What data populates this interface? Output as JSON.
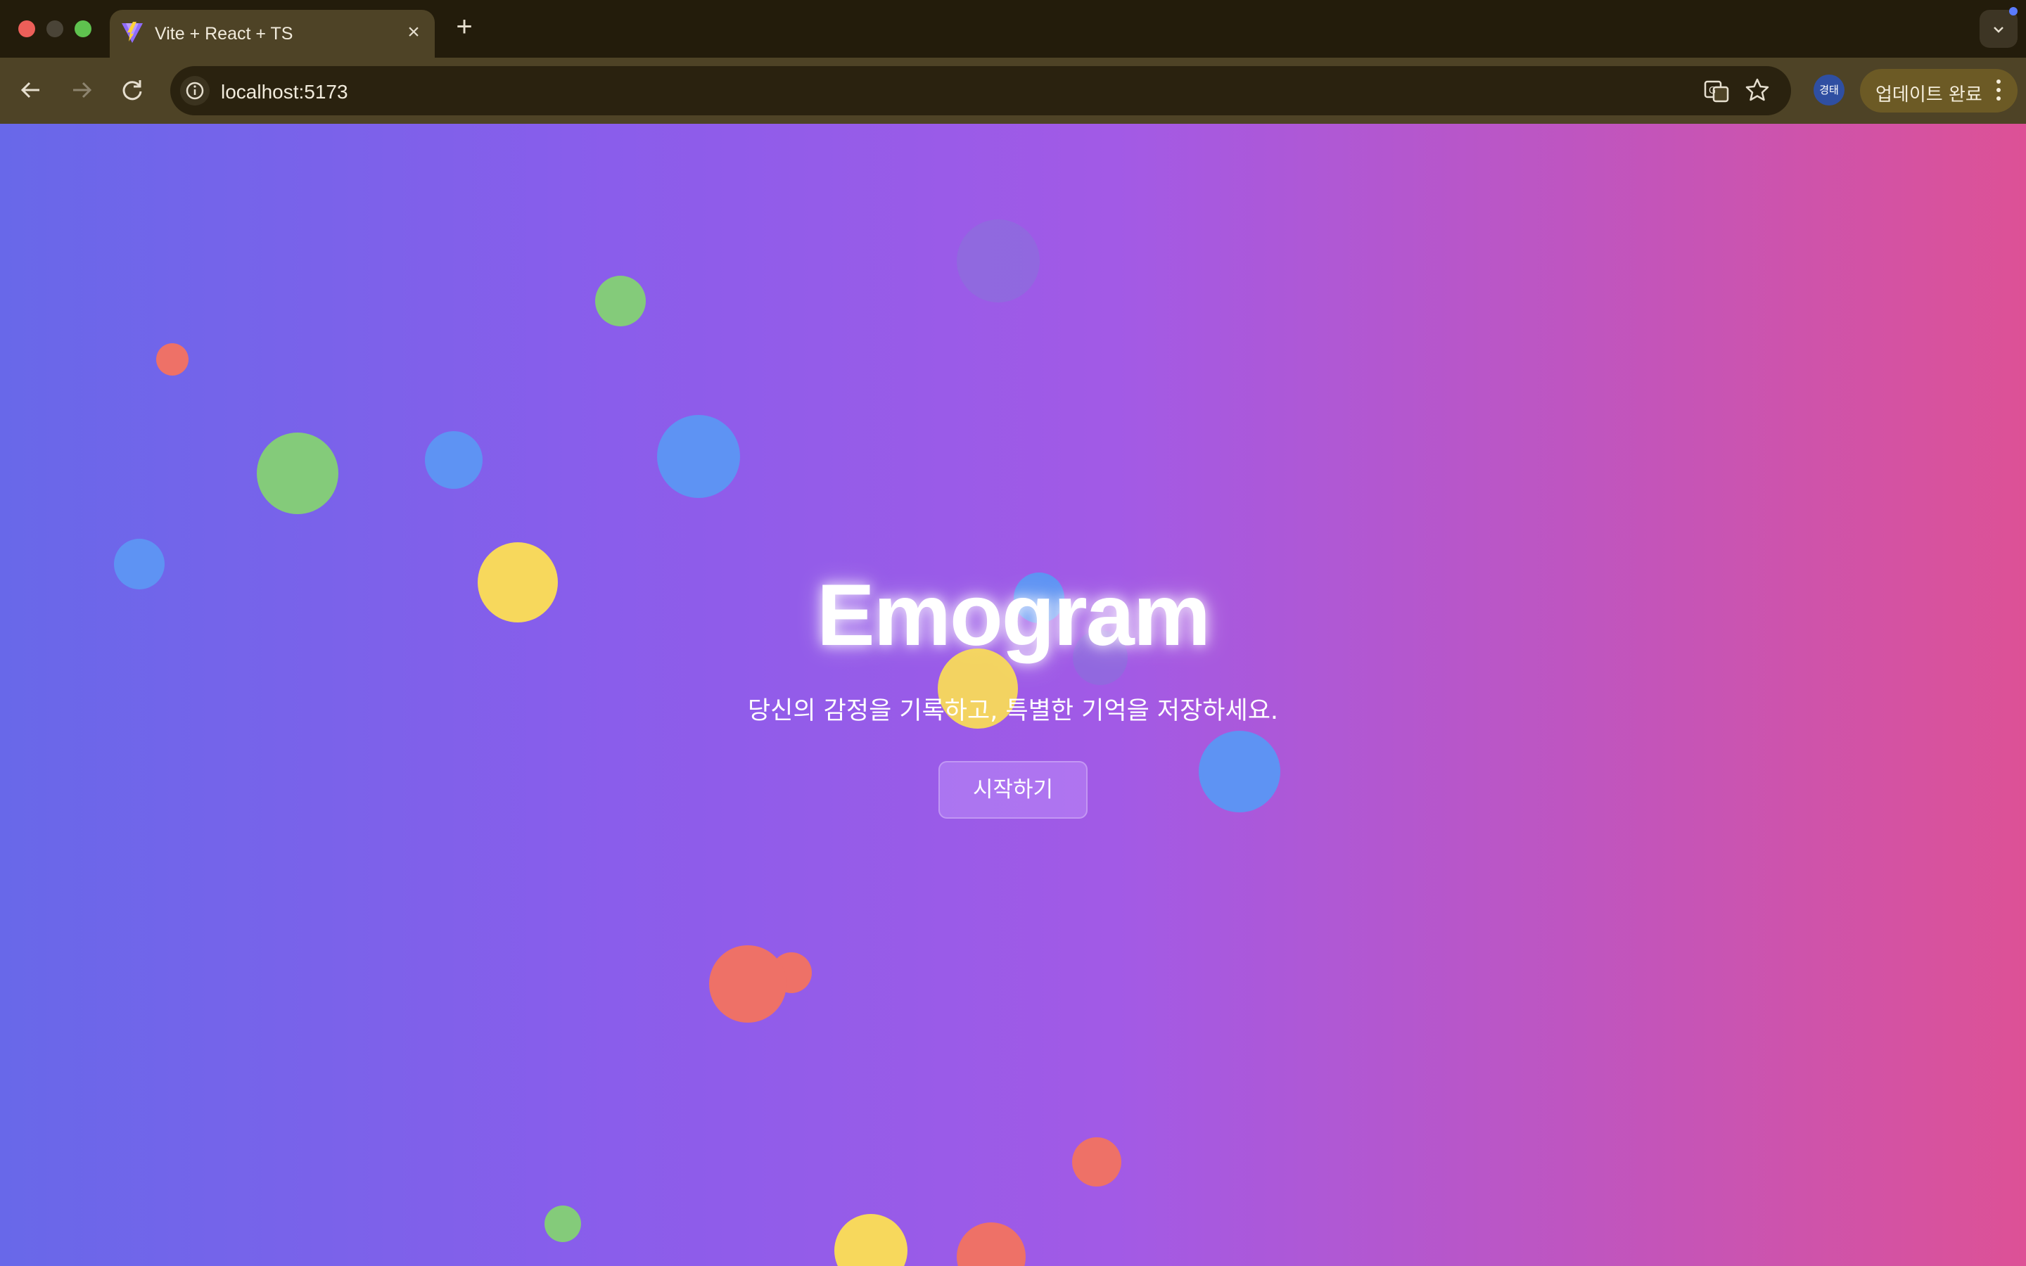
{
  "browser": {
    "tab": {
      "title": "Vite + React + TS",
      "favicon": "vite-logo-icon",
      "close_icon": "close-icon"
    },
    "new_tab_icon": "plus-icon",
    "tab_search_icon": "chevron-down-icon",
    "nav": {
      "back": "arrow-left-icon",
      "forward": "arrow-right-icon",
      "reload": "reload-icon"
    },
    "omnibox": {
      "url": "localhost:5173",
      "info_icon": "info-icon",
      "translate_icon": "translate-icon",
      "bookmark_icon": "star-icon"
    },
    "profile": {
      "label": "경태"
    },
    "update_button": {
      "label": "업데이트 완료"
    }
  },
  "page": {
    "title": "Emogram",
    "subtitle": "당신의 감정을 기록하고, 특별한 기억을 저장하세요.",
    "cta_label": "시작하기"
  },
  "colors": {
    "gradient_start": "#6868e9",
    "gradient_end": "#dd5196",
    "bubble_green": "#84cb7a",
    "bubble_blue": "#5e93f3",
    "bubble_yellow": "#f7d85c",
    "bubble_red": "#ee7167"
  }
}
